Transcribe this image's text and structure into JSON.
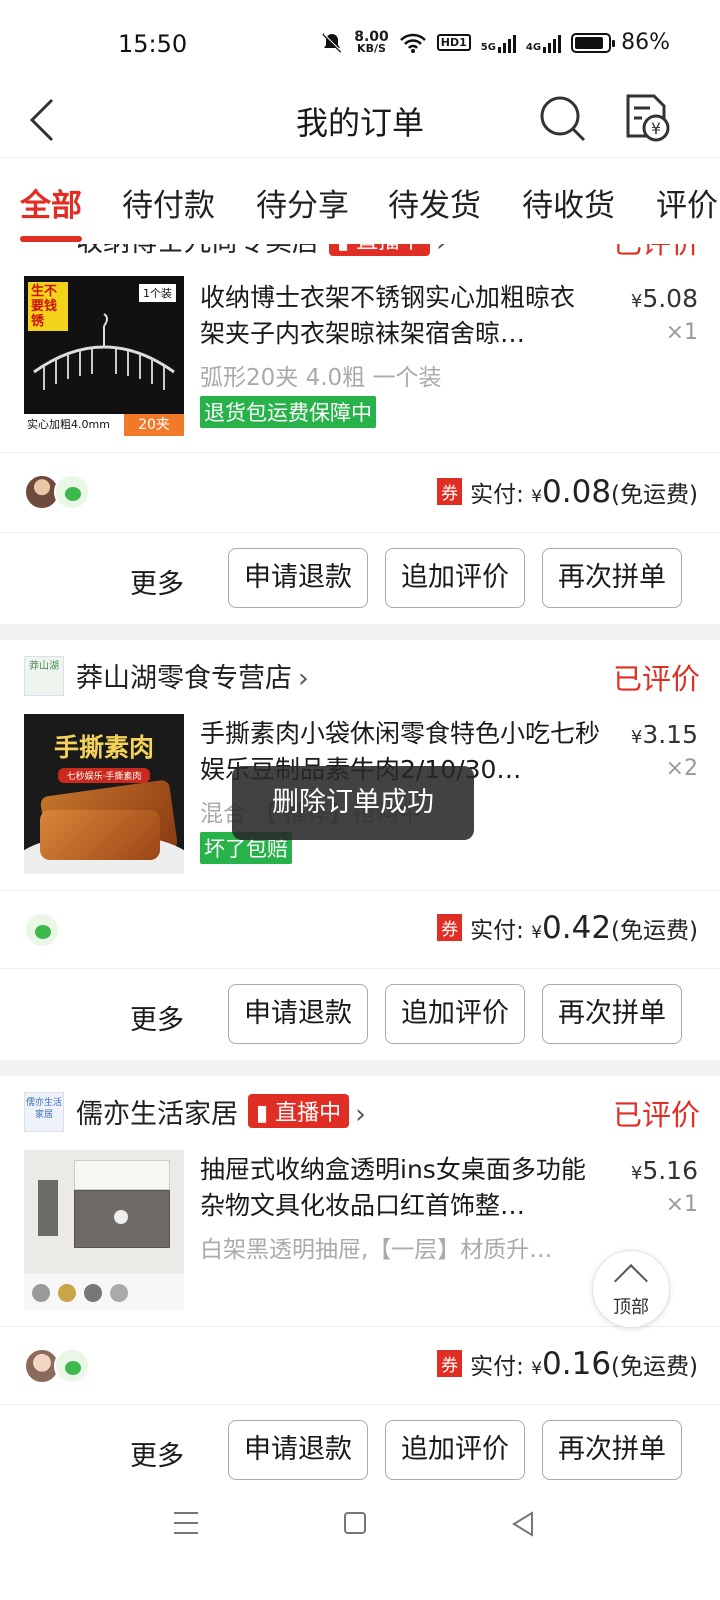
{
  "status_bar": {
    "time": "15:50",
    "net_speed": "8.00",
    "net_unit": "KB/S",
    "hd": "HD1",
    "sig1": "5G",
    "sig2": "4G",
    "battery": "86%"
  },
  "header": {
    "title": "我的订单"
  },
  "tabs": [
    "全部",
    "待付款",
    "待分享",
    "待发货",
    "待收货",
    "评价"
  ],
  "orders": [
    {
      "shop": "收纳博士九尚专卖店",
      "live": "直播中",
      "status": "已评价",
      "product": "收纳博士衣架不锈钢实心加粗晾衣架夹子内衣架晾袜架宿舍晾…",
      "price_symbol": "¥",
      "price": "5.08",
      "qty": "×1",
      "spec": "弧形20夹 4.0粗 一个装",
      "tag": "退货包运费保障中",
      "thumb": {
        "t1": "生不要钱锈",
        "t2": "1个装",
        "t3": "实心加粗4.0mm",
        "t4": "20夹"
      },
      "coupon": "券",
      "paid_label": "实付:",
      "paid_symbol": "¥",
      "paid": "0.08",
      "shipping": "(免运费)",
      "more": "更多",
      "buttons": [
        "申请退款",
        "追加评价",
        "再次拼单"
      ]
    },
    {
      "shop": "莽山湖零食专营店",
      "shop_logo": "莽山湖",
      "status": "已评价",
      "product": "手撕素肉小袋休闲零食特色小吃七秒娱乐豆制品素牛肉2/10/30…",
      "price_symbol": "¥",
      "price": "3.15",
      "qty": "×2",
      "spec": "混合 【 推荐】抢购中",
      "tag": "坏了包赔",
      "thumb": {
        "t1": "手撕素肉",
        "t2": "七秒娱乐·手撕素肉"
      },
      "coupon": "券",
      "paid_label": "实付:",
      "paid_symbol": "¥",
      "paid": "0.42",
      "shipping": "(免运费)",
      "more": "更多",
      "buttons": [
        "申请退款",
        "追加评价",
        "再次拼单"
      ]
    },
    {
      "shop": "儒亦生活家居",
      "shop_logo": "儒亦生活家居",
      "live": "直播中",
      "status": "已评价",
      "product": "抽屉式收纳盒透明ins女桌面多功能杂物文具化妆品口红首饰整…",
      "price_symbol": "¥",
      "price": "5.16",
      "qty": "×1",
      "spec": "白架黑透明抽屉,【一层】材质升…",
      "coupon": "券",
      "paid_label": "实付:",
      "paid_symbol": "¥",
      "paid": "0.16",
      "shipping": "(免运费)",
      "more": "更多",
      "buttons": [
        "申请退款",
        "追加评价",
        "再次拼单"
      ]
    }
  ],
  "toast": "删除订单成功",
  "back_to_top": "顶部",
  "colors": {
    "accent": "#e02e24",
    "green_tag": "#27b24a",
    "gap": "#f2f2f2"
  }
}
